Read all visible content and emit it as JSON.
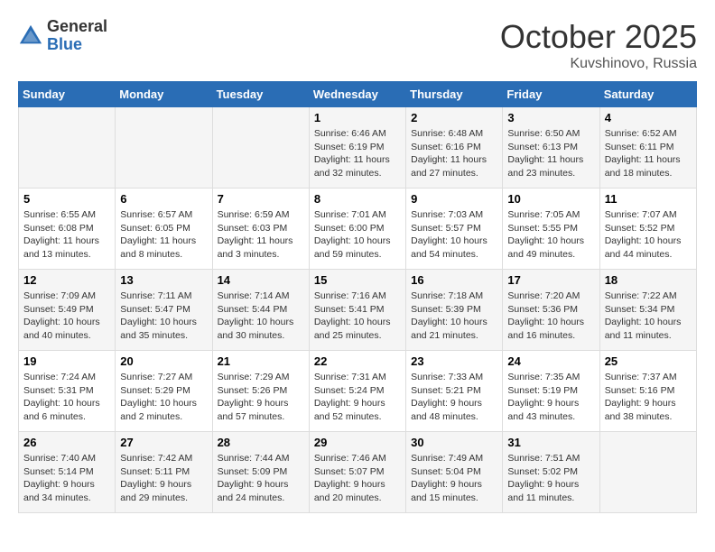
{
  "header": {
    "logo_general": "General",
    "logo_blue": "Blue",
    "month": "October 2025",
    "location": "Kuvshinovo, Russia"
  },
  "weekdays": [
    "Sunday",
    "Monday",
    "Tuesday",
    "Wednesday",
    "Thursday",
    "Friday",
    "Saturday"
  ],
  "weeks": [
    [
      {
        "day": "",
        "sunrise": "",
        "sunset": "",
        "daylight": ""
      },
      {
        "day": "",
        "sunrise": "",
        "sunset": "",
        "daylight": ""
      },
      {
        "day": "",
        "sunrise": "",
        "sunset": "",
        "daylight": ""
      },
      {
        "day": "1",
        "sunrise": "Sunrise: 6:46 AM",
        "sunset": "Sunset: 6:19 PM",
        "daylight": "Daylight: 11 hours and 32 minutes."
      },
      {
        "day": "2",
        "sunrise": "Sunrise: 6:48 AM",
        "sunset": "Sunset: 6:16 PM",
        "daylight": "Daylight: 11 hours and 27 minutes."
      },
      {
        "day": "3",
        "sunrise": "Sunrise: 6:50 AM",
        "sunset": "Sunset: 6:13 PM",
        "daylight": "Daylight: 11 hours and 23 minutes."
      },
      {
        "day": "4",
        "sunrise": "Sunrise: 6:52 AM",
        "sunset": "Sunset: 6:11 PM",
        "daylight": "Daylight: 11 hours and 18 minutes."
      }
    ],
    [
      {
        "day": "5",
        "sunrise": "Sunrise: 6:55 AM",
        "sunset": "Sunset: 6:08 PM",
        "daylight": "Daylight: 11 hours and 13 minutes."
      },
      {
        "day": "6",
        "sunrise": "Sunrise: 6:57 AM",
        "sunset": "Sunset: 6:05 PM",
        "daylight": "Daylight: 11 hours and 8 minutes."
      },
      {
        "day": "7",
        "sunrise": "Sunrise: 6:59 AM",
        "sunset": "Sunset: 6:03 PM",
        "daylight": "Daylight: 11 hours and 3 minutes."
      },
      {
        "day": "8",
        "sunrise": "Sunrise: 7:01 AM",
        "sunset": "Sunset: 6:00 PM",
        "daylight": "Daylight: 10 hours and 59 minutes."
      },
      {
        "day": "9",
        "sunrise": "Sunrise: 7:03 AM",
        "sunset": "Sunset: 5:57 PM",
        "daylight": "Daylight: 10 hours and 54 minutes."
      },
      {
        "day": "10",
        "sunrise": "Sunrise: 7:05 AM",
        "sunset": "Sunset: 5:55 PM",
        "daylight": "Daylight: 10 hours and 49 minutes."
      },
      {
        "day": "11",
        "sunrise": "Sunrise: 7:07 AM",
        "sunset": "Sunset: 5:52 PM",
        "daylight": "Daylight: 10 hours and 44 minutes."
      }
    ],
    [
      {
        "day": "12",
        "sunrise": "Sunrise: 7:09 AM",
        "sunset": "Sunset: 5:49 PM",
        "daylight": "Daylight: 10 hours and 40 minutes."
      },
      {
        "day": "13",
        "sunrise": "Sunrise: 7:11 AM",
        "sunset": "Sunset: 5:47 PM",
        "daylight": "Daylight: 10 hours and 35 minutes."
      },
      {
        "day": "14",
        "sunrise": "Sunrise: 7:14 AM",
        "sunset": "Sunset: 5:44 PM",
        "daylight": "Daylight: 10 hours and 30 minutes."
      },
      {
        "day": "15",
        "sunrise": "Sunrise: 7:16 AM",
        "sunset": "Sunset: 5:41 PM",
        "daylight": "Daylight: 10 hours and 25 minutes."
      },
      {
        "day": "16",
        "sunrise": "Sunrise: 7:18 AM",
        "sunset": "Sunset: 5:39 PM",
        "daylight": "Daylight: 10 hours and 21 minutes."
      },
      {
        "day": "17",
        "sunrise": "Sunrise: 7:20 AM",
        "sunset": "Sunset: 5:36 PM",
        "daylight": "Daylight: 10 hours and 16 minutes."
      },
      {
        "day": "18",
        "sunrise": "Sunrise: 7:22 AM",
        "sunset": "Sunset: 5:34 PM",
        "daylight": "Daylight: 10 hours and 11 minutes."
      }
    ],
    [
      {
        "day": "19",
        "sunrise": "Sunrise: 7:24 AM",
        "sunset": "Sunset: 5:31 PM",
        "daylight": "Daylight: 10 hours and 6 minutes."
      },
      {
        "day": "20",
        "sunrise": "Sunrise: 7:27 AM",
        "sunset": "Sunset: 5:29 PM",
        "daylight": "Daylight: 10 hours and 2 minutes."
      },
      {
        "day": "21",
        "sunrise": "Sunrise: 7:29 AM",
        "sunset": "Sunset: 5:26 PM",
        "daylight": "Daylight: 9 hours and 57 minutes."
      },
      {
        "day": "22",
        "sunrise": "Sunrise: 7:31 AM",
        "sunset": "Sunset: 5:24 PM",
        "daylight": "Daylight: 9 hours and 52 minutes."
      },
      {
        "day": "23",
        "sunrise": "Sunrise: 7:33 AM",
        "sunset": "Sunset: 5:21 PM",
        "daylight": "Daylight: 9 hours and 48 minutes."
      },
      {
        "day": "24",
        "sunrise": "Sunrise: 7:35 AM",
        "sunset": "Sunset: 5:19 PM",
        "daylight": "Daylight: 9 hours and 43 minutes."
      },
      {
        "day": "25",
        "sunrise": "Sunrise: 7:37 AM",
        "sunset": "Sunset: 5:16 PM",
        "daylight": "Daylight: 9 hours and 38 minutes."
      }
    ],
    [
      {
        "day": "26",
        "sunrise": "Sunrise: 7:40 AM",
        "sunset": "Sunset: 5:14 PM",
        "daylight": "Daylight: 9 hours and 34 minutes."
      },
      {
        "day": "27",
        "sunrise": "Sunrise: 7:42 AM",
        "sunset": "Sunset: 5:11 PM",
        "daylight": "Daylight: 9 hours and 29 minutes."
      },
      {
        "day": "28",
        "sunrise": "Sunrise: 7:44 AM",
        "sunset": "Sunset: 5:09 PM",
        "daylight": "Daylight: 9 hours and 24 minutes."
      },
      {
        "day": "29",
        "sunrise": "Sunrise: 7:46 AM",
        "sunset": "Sunset: 5:07 PM",
        "daylight": "Daylight: 9 hours and 20 minutes."
      },
      {
        "day": "30",
        "sunrise": "Sunrise: 7:49 AM",
        "sunset": "Sunset: 5:04 PM",
        "daylight": "Daylight: 9 hours and 15 minutes."
      },
      {
        "day": "31",
        "sunrise": "Sunrise: 7:51 AM",
        "sunset": "Sunset: 5:02 PM",
        "daylight": "Daylight: 9 hours and 11 minutes."
      },
      {
        "day": "",
        "sunrise": "",
        "sunset": "",
        "daylight": ""
      }
    ]
  ]
}
